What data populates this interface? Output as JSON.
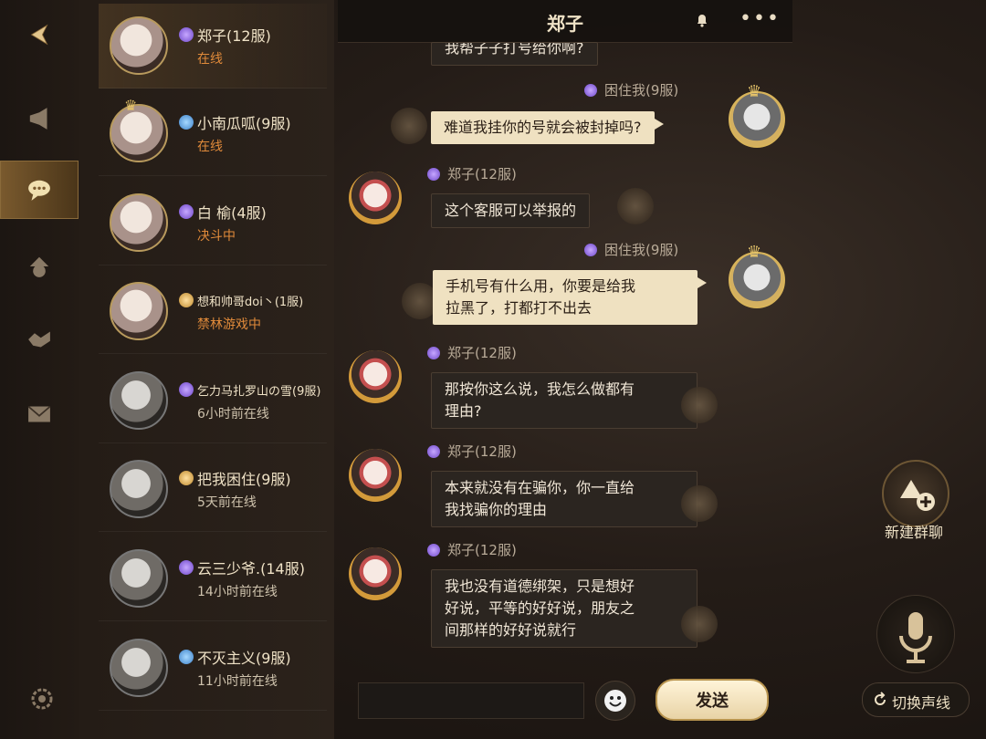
{
  "header": {
    "title": "郑子"
  },
  "contacts": [
    {
      "name": "郑子(12服)",
      "status": "在线"
    },
    {
      "name": "小南瓜呱(9服)",
      "status": "在线"
    },
    {
      "name": "白  榆(4服)",
      "status": "决斗中"
    },
    {
      "name": "想和帅哥doi丶(1服)",
      "status": "禁林游戏中"
    },
    {
      "name": "乞力马扎罗山の雪(9服)",
      "status": "6小时前在线"
    },
    {
      "name": "把我困住(9服)",
      "status": "5天前在线"
    },
    {
      "name": "云三少爷.(14服)",
      "status": "14小时前在线"
    },
    {
      "name": "不灭主义(9服)",
      "status": "11小时前在线"
    }
  ],
  "messages": [
    {
      "sender": "困住我(9服)",
      "text": "难道我挂你的号就会被封掉吗?"
    },
    {
      "sender": "郑子(12服)",
      "text": "这个客服可以举报的"
    },
    {
      "sender": "困住我(9服)",
      "line1": "手机号有什么用，你要是给我",
      "line2": "拉黑了，打都打不出去"
    },
    {
      "sender": "郑子(12服)",
      "line1": "那按你这么说，我怎么做都有",
      "line2": "理由?"
    },
    {
      "sender": "郑子(12服)",
      "line1": "本来就没有在骗你，你一直给",
      "line2": "我找骗你的理由"
    },
    {
      "sender": "郑子(12服)",
      "line1": "我也没有道德绑架，只是想好",
      "line2": "好说，平等的好好说，朋友之",
      "line3": "间那样的好好说就行"
    }
  ],
  "partial_top": "我帮子子打号给你啊?",
  "right_panel": {
    "new_group_label": "新建群聊",
    "switch_voice_label": "切换声线"
  },
  "input_bar": {
    "send_label": "发送"
  }
}
